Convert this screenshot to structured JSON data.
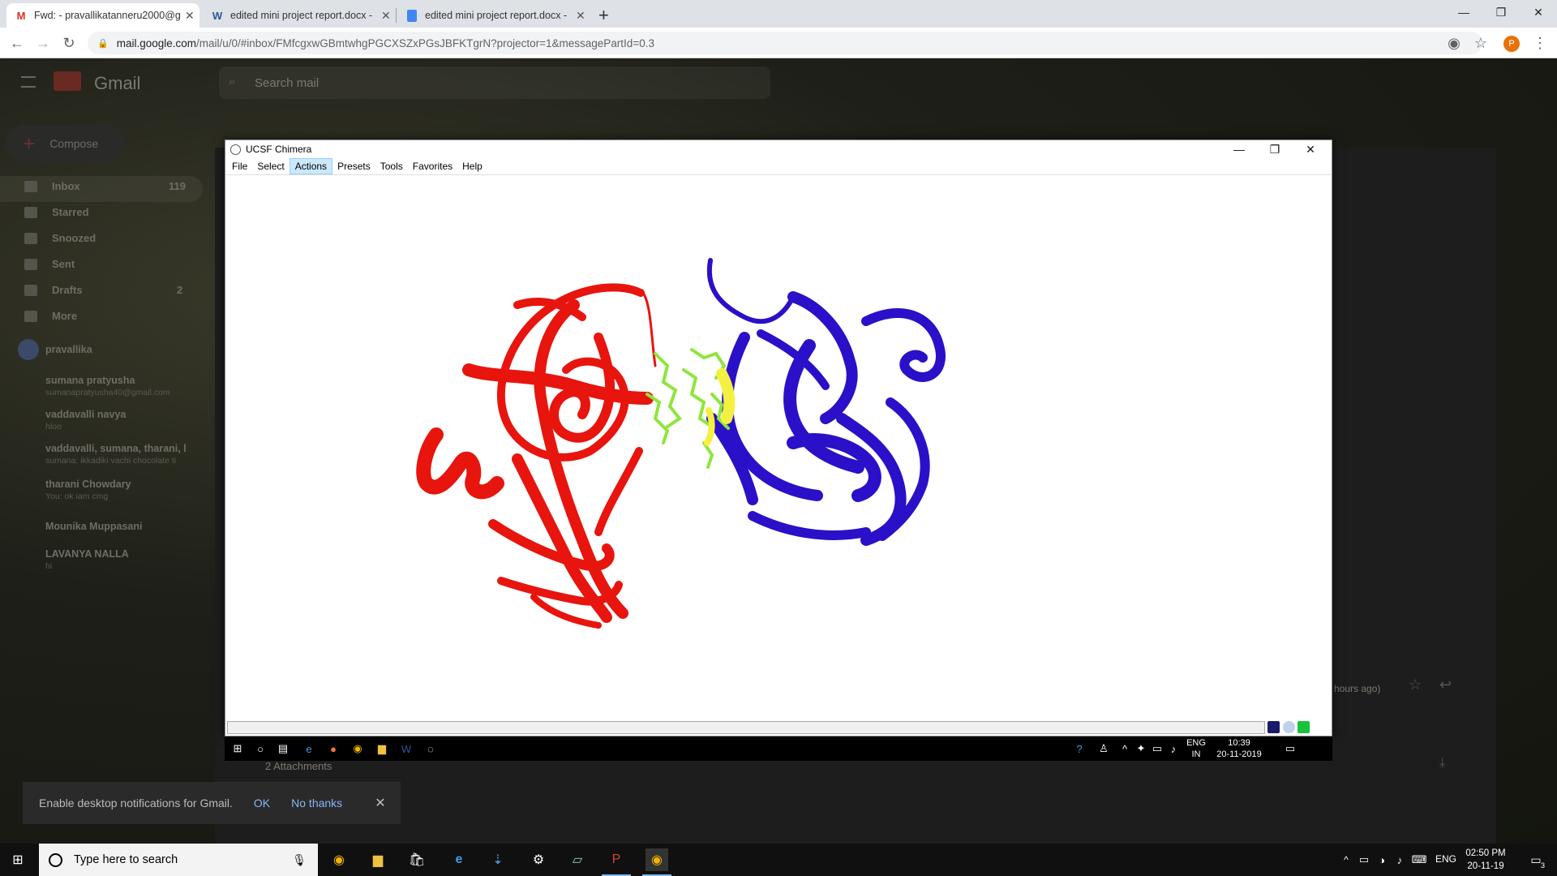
{
  "browser": {
    "tabs": [
      {
        "label": "Fwd: - pravallikatanneru2000@g",
        "icon": "gmail-icon",
        "active": true
      },
      {
        "label": "edited mini project report.docx -",
        "icon": "word-icon",
        "active": false
      },
      {
        "label": "edited mini project report.docx -",
        "icon": "docs-icon",
        "active": false
      }
    ],
    "new_tab": "+",
    "url_host": "mail.google.com",
    "url_path": "/mail/u/0/#inbox/FMfcgxwGBmtwhgPGCXSZxPGsJBFKTgrN?projector=1&messagePartId=0.3",
    "profile_initial": "P"
  },
  "gmail": {
    "app_name": "Gmail",
    "search_placeholder": "Search mail",
    "compose": "Compose",
    "nav": [
      {
        "label": "Inbox",
        "count": "119"
      },
      {
        "label": "Starred",
        "count": ""
      },
      {
        "label": "Snoozed",
        "count": ""
      },
      {
        "label": "Sent",
        "count": ""
      },
      {
        "label": "Drafts",
        "count": "2"
      },
      {
        "label": "More",
        "count": ""
      }
    ],
    "user": "pravallika",
    "chats": [
      {
        "name": "sumana pratyusha",
        "sub": "sumanapratyusha40@gmail.com"
      },
      {
        "name": "vaddavalli navya",
        "sub": "hloo"
      },
      {
        "name": "vaddavalli, sumana, tharani, l",
        "sub": "sumana: ikkadiki vachi chocolate ti"
      },
      {
        "name": "tharani Chowdary",
        "sub": "You: ok iam cmg"
      },
      {
        "name": "Mounika Muppasani",
        "sub": ""
      },
      {
        "name": "LAVANYA NALLA",
        "sub": "hi"
      }
    ],
    "attachments": "2 Attachments",
    "time_ago": "hours ago)",
    "notification": {
      "text": "Enable desktop notifications for Gmail.",
      "ok": "OK",
      "no": "No thanks",
      "close": "✕"
    }
  },
  "chimera": {
    "title": "UCSF Chimera",
    "menu": [
      "File",
      "Select",
      "Actions",
      "Presets",
      "Tools",
      "Favorites",
      "Help"
    ],
    "highlighted_menu": "Actions",
    "colors": {
      "chain_a": "#e8140e",
      "chain_b": "#2a10c8",
      "ligand": "#8ee63c",
      "contact": "#f4f040"
    }
  },
  "inner_taskbar": {
    "lang_top": "ENG",
    "lang_bottom": "IN",
    "time": "10:39",
    "date": "20-11-2019"
  },
  "taskbar": {
    "search_placeholder": "Type here to search",
    "lang": "ENG",
    "time": "02:50 PM",
    "date": "20-11-19",
    "notif_count": "3"
  }
}
